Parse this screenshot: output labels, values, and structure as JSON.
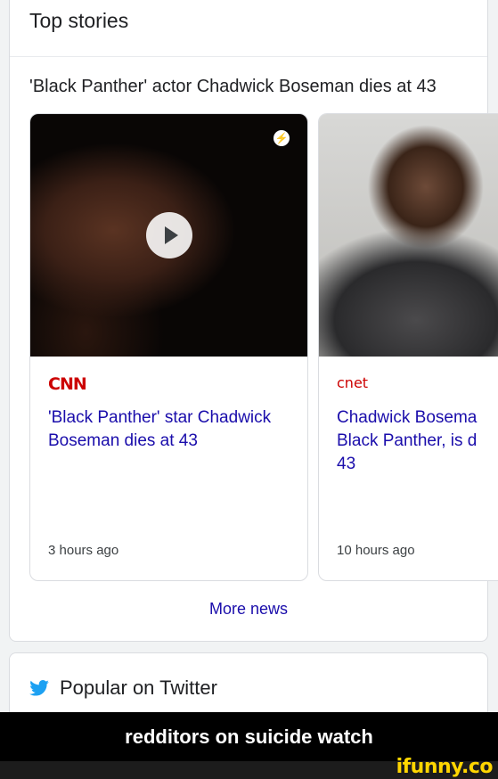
{
  "top_stories": {
    "title": "Top stories",
    "headline": "'Black Panther' actor Chadwick Boseman dies at 43",
    "stories": [
      {
        "source": "CNN",
        "title": "'Black Panther' star Chadwick Boseman dies at 43",
        "time": "3 hours ago",
        "has_video": true,
        "amp_icon": "lightning-bolt-icon"
      },
      {
        "source": "cnet",
        "title": "Chadwick Bosema Black Panther, is d 43",
        "title_lines": [
          "Chadwick Bosema",
          "Black Panther, is d",
          "43"
        ],
        "time": "10 hours ago"
      }
    ],
    "more_news": "More news"
  },
  "twitter": {
    "title": "Popular on Twitter",
    "icon": "twitter-bird-icon"
  },
  "caption": "redditors on suicide watch",
  "watermark": "ifunny.co",
  "colors": {
    "link": "#1a0dab",
    "cnn_red": "#cc0000",
    "twitter_blue": "#1da1f2",
    "watermark": "#ffd600"
  }
}
